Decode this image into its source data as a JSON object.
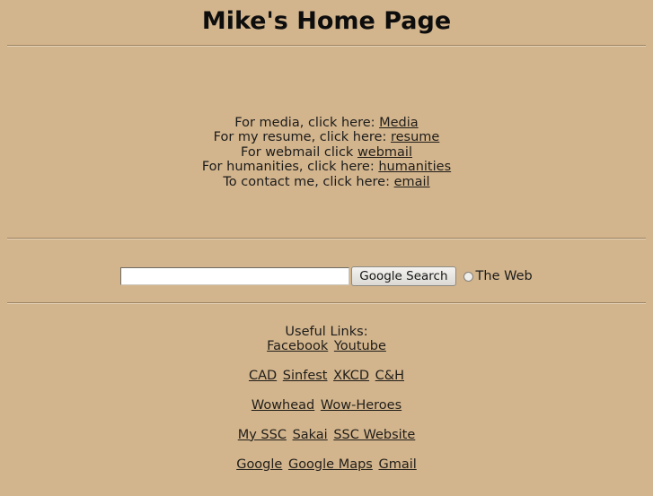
{
  "page": {
    "title": "Mike's Home Page",
    "background_color": "#d3b58d",
    "link_color": "#201d19",
    "text_color": "#1b1b1b"
  },
  "intro": {
    "lines": [
      {
        "prefix": "For media, click here: ",
        "link": "Media"
      },
      {
        "prefix": "For my resume, click here: ",
        "link": "resume"
      },
      {
        "prefix": "For webmail click ",
        "link": "webmail"
      },
      {
        "prefix": "For humanities, click here: ",
        "link": "humanities"
      },
      {
        "prefix": "To contact me, click here: ",
        "link": "email"
      }
    ]
  },
  "search": {
    "value": "",
    "placeholder": "",
    "button_label": "Google Search",
    "scope_label": "The Web",
    "scope_checked": false
  },
  "useful": {
    "heading": "Useful Links:",
    "groups": [
      {
        "links": [
          "Facebook",
          "Youtube"
        ]
      },
      {
        "links": [
          "CAD",
          "Sinfest",
          "XKCD",
          "C&H"
        ]
      },
      {
        "links": [
          "Wowhead",
          "Wow-Heroes"
        ]
      },
      {
        "links": [
          "My SSC",
          "Sakai",
          "SSC Website"
        ]
      },
      {
        "links": [
          "Google",
          "Google Maps",
          "Gmail"
        ]
      }
    ]
  }
}
